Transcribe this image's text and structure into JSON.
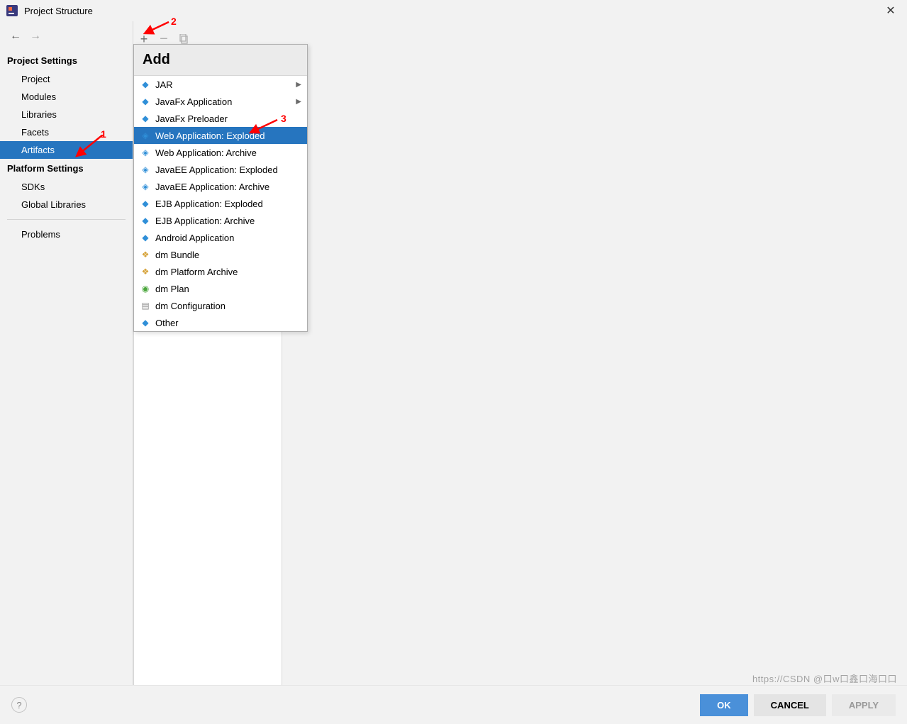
{
  "title": "Project Structure",
  "sidebar": {
    "section1_label": "Project Settings",
    "section2_label": "Platform Settings",
    "items1": [
      "Project",
      "Modules",
      "Libraries",
      "Facets",
      "Artifacts"
    ],
    "selected1_index": 4,
    "items2": [
      "SDKs",
      "Global Libraries"
    ],
    "problems_label": "Problems"
  },
  "dropdown": {
    "header": "Add",
    "items": [
      {
        "label": "JAR",
        "icon": "module-icon",
        "submenu": true,
        "cls": "ficon-blue"
      },
      {
        "label": "JavaFx Application",
        "icon": "module-icon",
        "submenu": true,
        "cls": "ficon-blue"
      },
      {
        "label": "JavaFx Preloader",
        "icon": "module-icon",
        "submenu": false,
        "cls": "ficon-blue"
      },
      {
        "label": "Web Application: Exploded",
        "icon": "web-icon",
        "submenu": false,
        "cls": "ficon-blue",
        "selected": true
      },
      {
        "label": "Web Application: Archive",
        "icon": "web-icon",
        "submenu": false,
        "cls": "ficon-blue"
      },
      {
        "label": "JavaEE Application: Exploded",
        "icon": "javaee-icon",
        "submenu": false,
        "cls": "ficon-blue"
      },
      {
        "label": "JavaEE Application: Archive",
        "icon": "javaee-icon",
        "submenu": false,
        "cls": "ficon-blue"
      },
      {
        "label": "EJB Application: Exploded",
        "icon": "ejb-icon",
        "submenu": false,
        "cls": "ficon-blue"
      },
      {
        "label": "EJB Application: Archive",
        "icon": "ejb-icon",
        "submenu": false,
        "cls": "ficon-blue"
      },
      {
        "label": "Android Application",
        "icon": "android-icon",
        "submenu": false,
        "cls": "ficon-blue"
      },
      {
        "label": "dm Bundle",
        "icon": "bundle-icon",
        "submenu": false,
        "cls": "ficon-gold"
      },
      {
        "label": "dm Platform Archive",
        "icon": "bundle-icon",
        "submenu": false,
        "cls": "ficon-gold"
      },
      {
        "label": "dm Plan",
        "icon": "plan-icon",
        "submenu": false,
        "cls": "ficon-green"
      },
      {
        "label": "dm Configuration",
        "icon": "config-icon",
        "submenu": false,
        "cls": "ficon-gray"
      },
      {
        "label": "Other",
        "icon": "module-icon",
        "submenu": false,
        "cls": "ficon-blue"
      }
    ]
  },
  "footer": {
    "ok": "OK",
    "cancel": "CANCEL",
    "apply": "APPLY"
  },
  "annotations": {
    "n1": "1",
    "n2": "2",
    "n3": "3"
  },
  "watermark": "https://CSDN @口w口鑫口海口口"
}
